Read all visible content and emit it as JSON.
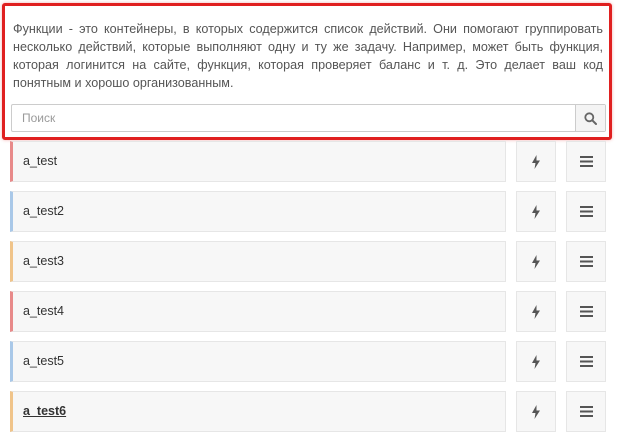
{
  "info": {
    "description": "Функции - это контейнеры, в которых содержится список действий. Они помогают группировать несколько действий, которые выполняют одну и ту же задачу. Например, может быть функция, которая логинится на сайте, функция, которая проверяет баланс и т. д. Это делает ваш код понятным и хорошо организованным."
  },
  "search": {
    "placeholder": "Поиск",
    "value": ""
  },
  "colors": {
    "highlight": "#e02020",
    "red": "#e88a8a",
    "blue": "#a9c8e8",
    "orange": "#f0c48a"
  },
  "functions": [
    {
      "name": "a_test",
      "accent": "#e88a8a",
      "active": false
    },
    {
      "name": "a_test2",
      "accent": "#a9c8e8",
      "active": false
    },
    {
      "name": "a_test3",
      "accent": "#f0c48a",
      "active": false
    },
    {
      "name": "a_test4",
      "accent": "#e88a8a",
      "active": false
    },
    {
      "name": "a_test5",
      "accent": "#a9c8e8",
      "active": false
    },
    {
      "name": "a_test6",
      "accent": "#f0c48a",
      "active": true
    }
  ],
  "icons": {
    "search": "search-icon",
    "run": "lightning-icon",
    "menu": "hamburger-menu-icon"
  }
}
